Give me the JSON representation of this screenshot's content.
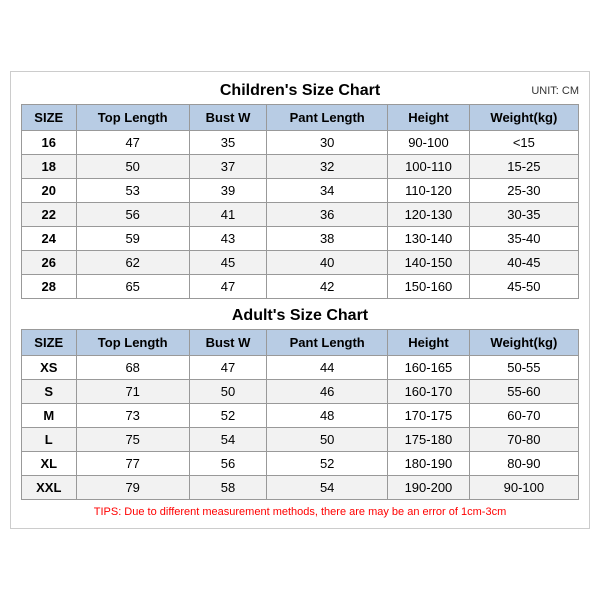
{
  "children_title": "Children's Size Chart",
  "adult_title": "Adult's Size Chart",
  "unit": "UNIT: CM",
  "tips": "TIPS: Due to different measurement methods, there are may be an error of 1cm-3cm",
  "table_headers": [
    "SIZE",
    "Top Length",
    "Bust W",
    "Pant Length",
    "Height",
    "Weight(kg)"
  ],
  "children_rows": [
    [
      "16",
      "47",
      "35",
      "30",
      "90-100",
      "<15"
    ],
    [
      "18",
      "50",
      "37",
      "32",
      "100-110",
      "15-25"
    ],
    [
      "20",
      "53",
      "39",
      "34",
      "110-120",
      "25-30"
    ],
    [
      "22",
      "56",
      "41",
      "36",
      "120-130",
      "30-35"
    ],
    [
      "24",
      "59",
      "43",
      "38",
      "130-140",
      "35-40"
    ],
    [
      "26",
      "62",
      "45",
      "40",
      "140-150",
      "40-45"
    ],
    [
      "28",
      "65",
      "47",
      "42",
      "150-160",
      "45-50"
    ]
  ],
  "adult_rows": [
    [
      "XS",
      "68",
      "47",
      "44",
      "160-165",
      "50-55"
    ],
    [
      "S",
      "71",
      "50",
      "46",
      "160-170",
      "55-60"
    ],
    [
      "M",
      "73",
      "52",
      "48",
      "170-175",
      "60-70"
    ],
    [
      "L",
      "75",
      "54",
      "50",
      "175-180",
      "70-80"
    ],
    [
      "XL",
      "77",
      "56",
      "52",
      "180-190",
      "80-90"
    ],
    [
      "XXL",
      "79",
      "58",
      "54",
      "190-200",
      "90-100"
    ]
  ]
}
